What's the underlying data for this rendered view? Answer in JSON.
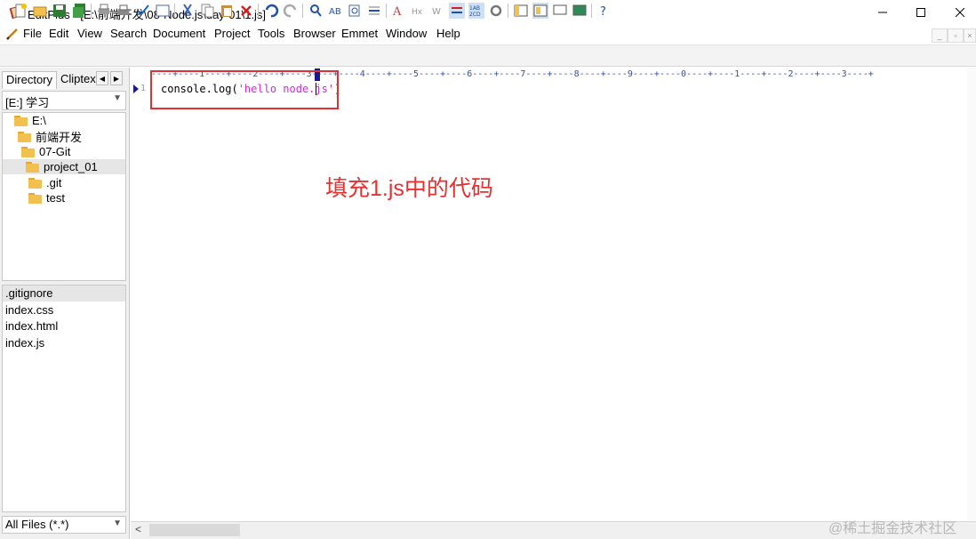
{
  "window": {
    "title": "EditPlus - [E:\\前端开发\\08-Node.js\\day-01\\1.js]",
    "icon": "editplus-icon"
  },
  "menu": {
    "items": [
      "File",
      "Edit",
      "View",
      "Search",
      "Document",
      "Project",
      "Tools",
      "Browser",
      "Emmet",
      "Window",
      "Help"
    ]
  },
  "sidebar": {
    "tabs": [
      "Directory",
      "Cliptext"
    ],
    "drive": "[E:] 学习",
    "tree": [
      {
        "label": "E:\\",
        "depth": 0
      },
      {
        "label": "前端开发",
        "depth": 1
      },
      {
        "label": "07-Git",
        "depth": 2
      },
      {
        "label": "project_01",
        "depth": 3,
        "selected": true
      },
      {
        "label": ".git",
        "depth": 4
      },
      {
        "label": "test",
        "depth": 4
      }
    ],
    "files": [
      ".gitignore",
      "index.css",
      "index.html",
      "index.js"
    ],
    "selected_file": ".gitignore",
    "filter": "All Files (*.*)"
  },
  "editor": {
    "ruler": "----+----1----+----2----+----3----+----4----+----5----+----6----+----7----+----8----+----9----+----0----+----1----+----2----+----3----+",
    "line_number": "1",
    "code_prefix": "console.log(",
    "code_string": "'hello node.js'",
    "code_suffix": ")",
    "annotation": "填充1.js中的代码"
  },
  "watermark": "@稀土掘金技术社区",
  "colors": {
    "highlight_border": "#e03030",
    "annotation_text": "#e83030",
    "string_literal": "#e020e0"
  }
}
